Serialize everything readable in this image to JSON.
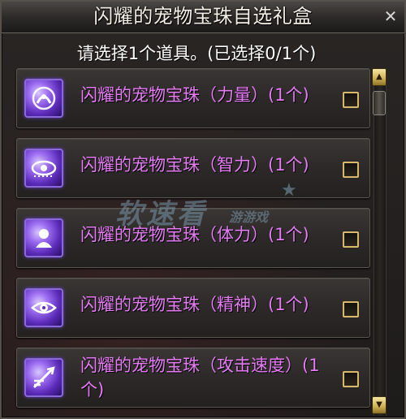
{
  "window": {
    "title": "闪耀的宠物宝珠自选礼盒",
    "close_glyph": "✕",
    "close_icon": "close-icon"
  },
  "instruction": "请选择1个道具。(已选择0/1个)",
  "items": [
    {
      "label": "闪耀的宠物宝珠（力量）(1个)",
      "icon": "pet-orb-strength-icon",
      "checked": false
    },
    {
      "label": "闪耀的宠物宝珠（智力）(1个)",
      "icon": "pet-orb-intelligence-icon",
      "checked": false
    },
    {
      "label": "闪耀的宠物宝珠（体力）(1个)",
      "icon": "pet-orb-vitality-icon",
      "checked": false
    },
    {
      "label": "闪耀的宠物宝珠（精神）(1个)",
      "icon": "pet-orb-spirit-icon",
      "checked": false
    },
    {
      "label": "闪耀的宠物宝珠（攻击速度）(1个)",
      "icon": "pet-orb-attack-speed-icon",
      "checked": false
    }
  ],
  "scrollbar": {
    "up_glyph": "▲",
    "down_glyph": "▼"
  },
  "watermark": {
    "big": "软速看",
    "small": "游游戏",
    "star": "★"
  },
  "colors": {
    "item_label": "#e57bf5",
    "checkbox_border": "#d6b96a",
    "scroll_button": "#cfae52",
    "icon_glow": "#9b6cf0"
  }
}
